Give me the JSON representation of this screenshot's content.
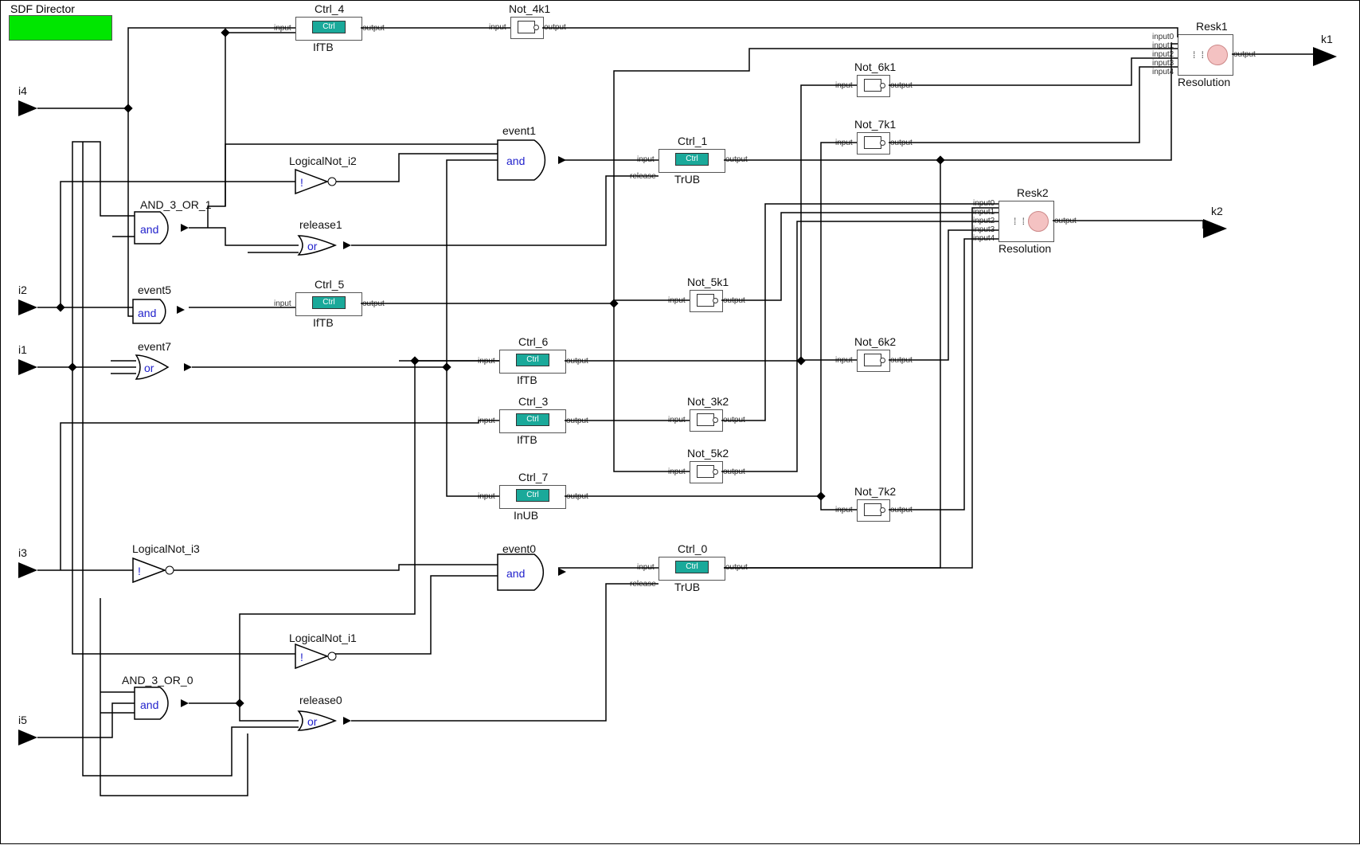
{
  "director": {
    "label": "SDF Director"
  },
  "inputs": {
    "i4": "i4",
    "i2": "i2",
    "i1": "i1",
    "i3": "i3",
    "i5": "i5"
  },
  "outputs": {
    "k1": "k1",
    "k2": "k2"
  },
  "gates": {
    "and_3_or_1": {
      "title": "AND_3_OR_1",
      "op": "and"
    },
    "event5": {
      "title": "event5",
      "op": "and"
    },
    "event7": {
      "title": "event7",
      "op": "or"
    },
    "logicalnot_i2": {
      "title": "LogicalNot_i2",
      "op": "!"
    },
    "release1": {
      "title": "release1",
      "op": "or"
    },
    "event1": {
      "title": "event1",
      "op": "and"
    },
    "logicalnot_i3": {
      "title": "LogicalNot_i3",
      "op": "!"
    },
    "logicalnot_i1": {
      "title": "LogicalNot_i1",
      "op": "!"
    },
    "and_3_or_0": {
      "title": "AND_3_OR_0",
      "op": "and"
    },
    "release0": {
      "title": "release0",
      "op": "or"
    },
    "event0": {
      "title": "event0",
      "op": "and"
    }
  },
  "ctrl": {
    "ctrl_4": {
      "title": "Ctrl_4",
      "inner": "Ctrl",
      "sub": "IfTB"
    },
    "ctrl_1": {
      "title": "Ctrl_1",
      "inner": "Ctrl",
      "sub": "TrUB"
    },
    "ctrl_5": {
      "title": "Ctrl_5",
      "inner": "Ctrl",
      "sub": "IfTB"
    },
    "ctrl_6": {
      "title": "Ctrl_6",
      "inner": "Ctrl",
      "sub": "IfTB"
    },
    "ctrl_3": {
      "title": "Ctrl_3",
      "inner": "Ctrl",
      "sub": "IfTB"
    },
    "ctrl_7": {
      "title": "Ctrl_7",
      "inner": "Ctrl",
      "sub": "InUB"
    },
    "ctrl_0": {
      "title": "Ctrl_0",
      "inner": "Ctrl",
      "sub": "TrUB"
    }
  },
  "nots": {
    "not_4k1": "Not_4k1",
    "not_6k1": "Not_6k1",
    "not_7k1": "Not_7k1",
    "not_5k1": "Not_5k1",
    "not_6k2": "Not_6k2",
    "not_3k2": "Not_3k2",
    "not_5k2": "Not_5k2",
    "not_7k2": "Not_7k2"
  },
  "res": {
    "resk1": {
      "title": "Resk1",
      "sub": "Resolution"
    },
    "resk2": {
      "title": "Resk2",
      "sub": "Resolution"
    }
  },
  "port_labels": {
    "input": "input",
    "output": "output",
    "release": "release",
    "input0": "input0",
    "input1": "input1",
    "input2": "input2",
    "input3": "input3",
    "input4": "input4"
  }
}
